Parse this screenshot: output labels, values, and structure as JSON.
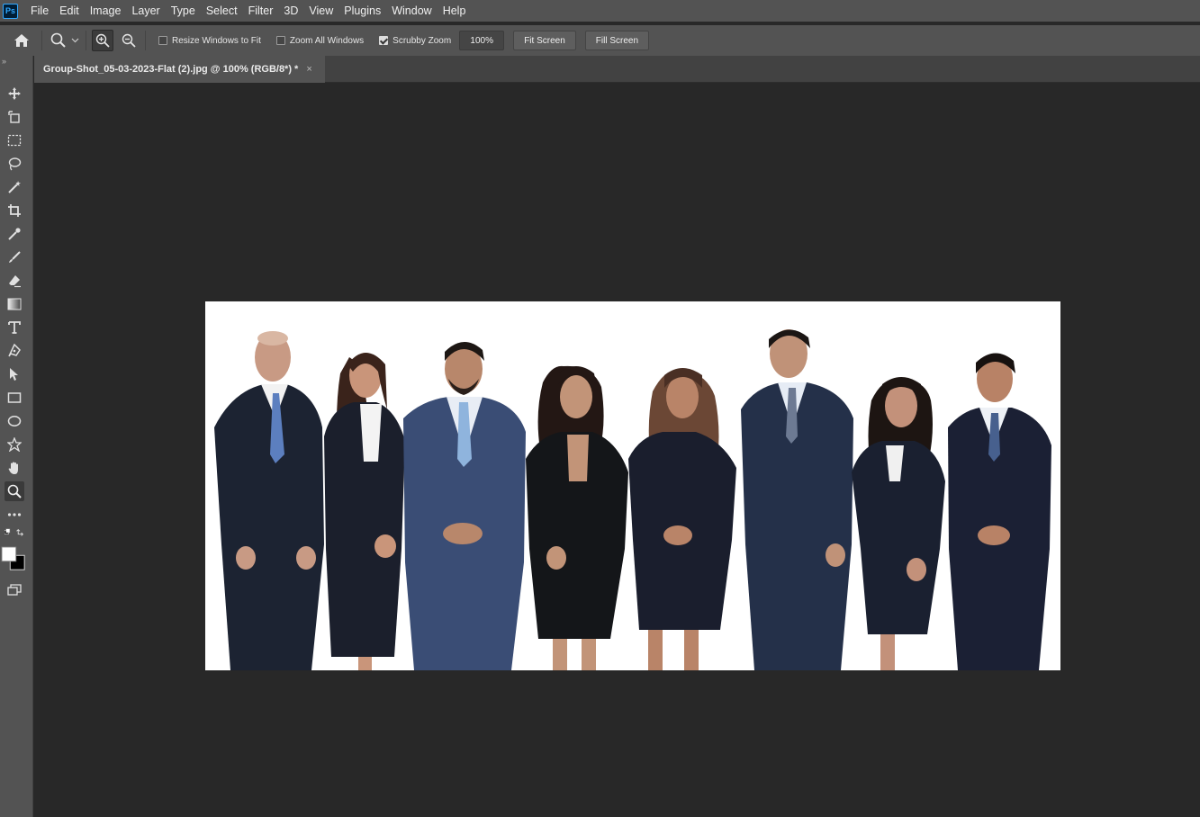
{
  "app": {
    "logo": "Ps"
  },
  "menu": [
    "File",
    "Edit",
    "Image",
    "Layer",
    "Type",
    "Select",
    "Filter",
    "3D",
    "View",
    "Plugins",
    "Window",
    "Help"
  ],
  "options": {
    "resize_windows": "Resize Windows to Fit",
    "zoom_all": "Zoom All Windows",
    "scrubby_zoom": "Scrubby Zoom",
    "zoom_value": "100%",
    "fit_screen": "Fit Screen",
    "fill_screen": "Fill Screen"
  },
  "toolbar": {
    "grip": "»"
  },
  "document": {
    "tab_title": "Group-Shot_05-03-2023-Flat (2).jpg @ 100% (RGB/8*) *",
    "close_glyph": "×"
  },
  "colors": {
    "ui_panel": "#535353",
    "canvas_bg": "#282828",
    "image_bg": "#ffffff",
    "suit_navy": "#1b2233",
    "suit_blue": "#3a4d75"
  }
}
